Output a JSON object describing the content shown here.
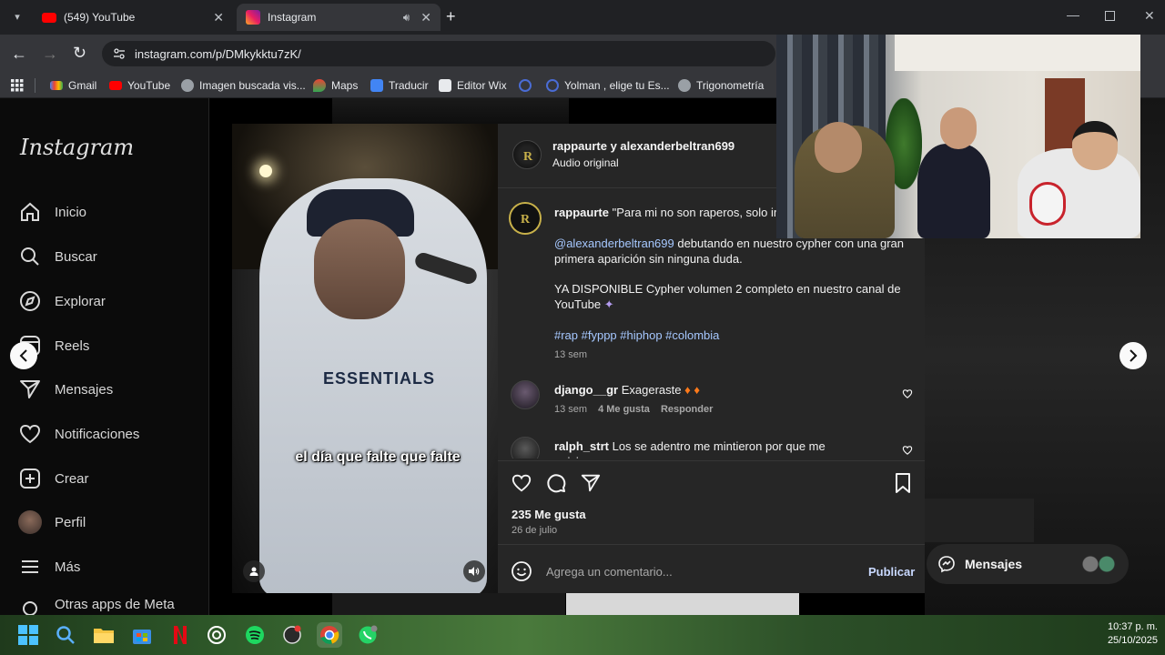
{
  "browser": {
    "tabs": [
      {
        "title": "(549) YouTube",
        "active": false
      },
      {
        "title": "Instagram",
        "active": true
      }
    ],
    "url": "instagram.com/p/DMkykktu7zK/",
    "bookmarks": [
      "Gmail",
      "YouTube",
      "Imagen buscada vis...",
      "Maps",
      "Traducir",
      "Editor Wix",
      "Yolman , elige tu Es...",
      "Trigonometría"
    ]
  },
  "sidebar": {
    "logo": "Instagram",
    "items": [
      "Inicio",
      "Buscar",
      "Explorar",
      "Reels",
      "Mensajes",
      "Notificaciones",
      "Crear",
      "Perfil",
      "Más",
      "Otras apps de Meta"
    ]
  },
  "video": {
    "subtitle": "el día que falte que falte",
    "hoodie_text": "ESSENTIALS"
  },
  "post": {
    "header_user": "rappaurte y alexanderbeltran699",
    "header_audio": "Audio original",
    "caption_user": "rappaurte",
    "caption_start": "\"Para mi no son raperos, solo ir",
    "mention": "@alexanderbeltran699",
    "caption_p1": " debutando en nuestro cypher con una gran primera aparición sin ninguna duda.",
    "caption_p2": "YA DISPONIBLE Cypher volumen 2 completo en nuestro canal de YouTube",
    "hashtags": "#rap #fyppp #hiphop #colombia",
    "caption_time": "13 sem",
    "comments": [
      {
        "user": "django__gr",
        "text": "Exageraste",
        "time": "13 sem",
        "likes": "4 Me gusta",
        "reply": "Responder"
      },
      {
        "user": "ralph_strt",
        "text": "Los se adentro me mintieron por que me quisieron"
      }
    ],
    "likes": "235 Me gusta",
    "date": "26 de julio",
    "comment_placeholder": "Agrega un comentario...",
    "publish": "Publicar"
  },
  "messages_pill": "Mensajes",
  "taskbar": {
    "time": "10:37 p. m.",
    "date": "25/10/2025"
  },
  "colors": {
    "accent_link": "#a6c8ff",
    "panel_bg": "#262626"
  }
}
